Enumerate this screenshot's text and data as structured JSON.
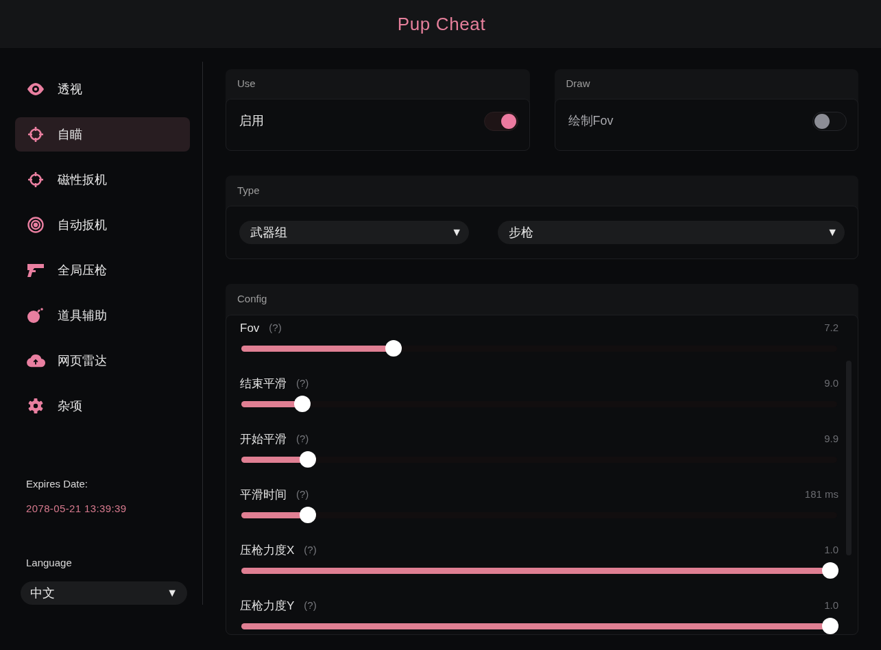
{
  "window": {
    "title": "Pup Cheat"
  },
  "sidebar": {
    "items": [
      {
        "label": "透视",
        "selected": false
      },
      {
        "label": "自瞄",
        "selected": true
      },
      {
        "label": "磁性扳机",
        "selected": false
      },
      {
        "label": "自动扳机",
        "selected": false
      },
      {
        "label": "全局压枪",
        "selected": false
      },
      {
        "label": "道具辅助",
        "selected": false
      },
      {
        "label": "网页雷达",
        "selected": false
      },
      {
        "label": "杂项",
        "selected": false
      }
    ],
    "expires_label": "Expires Date:",
    "expires_value": "2078-05-21 13:39:39",
    "language_label": "Language",
    "language_value": "中文",
    "language_caret": "▼"
  },
  "use": {
    "title": "Use",
    "label": "启用",
    "on": true
  },
  "draw": {
    "title": "Draw",
    "label": "绘制Fov",
    "on": false
  },
  "type": {
    "title": "Type",
    "dropdowns": [
      {
        "value": "武器组",
        "caret": "▼"
      },
      {
        "value": "步枪",
        "caret": "▼"
      }
    ]
  },
  "config": {
    "title": "Config",
    "sliders": [
      {
        "label": "Fov",
        "hint": "(?)",
        "reading": "7.2",
        "level": 0.25
      },
      {
        "label": "结束平滑",
        "hint": "(?)",
        "reading": "9.0",
        "level": 0.093
      },
      {
        "label": "开始平滑",
        "hint": "(?)",
        "reading": "9.9",
        "level": 0.102
      },
      {
        "label": "平滑时间",
        "hint": "(?)",
        "reading": "181 ms",
        "level": 0.102
      },
      {
        "label": "压枪力度X",
        "hint": "(?)",
        "reading": "1.0",
        "level": 1.0
      },
      {
        "label": "压枪力度Y",
        "hint": "(?)",
        "reading": "1.0",
        "level": 1.0
      }
    ]
  }
}
